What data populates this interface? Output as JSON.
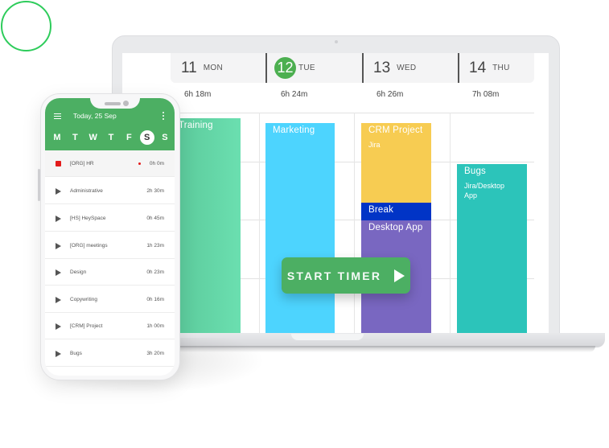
{
  "decor": {
    "circle_color": "#2ecc5b"
  },
  "calendar": {
    "days": [
      {
        "num": "11",
        "name": "MON",
        "total": "6h 18m",
        "today": false
      },
      {
        "num": "12",
        "name": "TUE",
        "total": "6h 24m",
        "today": true
      },
      {
        "num": "13",
        "name": "WED",
        "total": "6h 26m",
        "today": false
      },
      {
        "num": "14",
        "name": "THU",
        "total": "7h 08m",
        "today": false
      }
    ],
    "events": [
      {
        "day": "MON",
        "title": "Training",
        "subtitle": "",
        "color": "#66dcae"
      },
      {
        "day": "TUE",
        "title": "Marketing",
        "subtitle": "",
        "color": "#4dd4fe"
      },
      {
        "day": "WED",
        "title": "CRM Project",
        "subtitle": "Jira",
        "color": "#f7cc52"
      },
      {
        "day": "WED",
        "title": "Break",
        "subtitle": "",
        "color": "#0134c6"
      },
      {
        "day": "WED",
        "title": "Desktop App",
        "subtitle": "",
        "color": "#7967c1"
      },
      {
        "day": "THU",
        "title": "Bugs",
        "subtitle": "Jira/Desktop App",
        "color": "#2cc4ba"
      }
    ],
    "start_timer_label": "START TIMER",
    "accent": "#4caf63"
  },
  "phone": {
    "date_label": "Today, 25 Sep",
    "weekdays": [
      "M",
      "T",
      "W",
      "T",
      "F",
      "S",
      "S"
    ],
    "active_weekday_index": 5,
    "tasks": [
      {
        "name": "[ORG] HR",
        "duration": "0h 0m",
        "state": "recording"
      },
      {
        "name": "Administrative",
        "duration": "2h 30m",
        "state": "stopped"
      },
      {
        "name": "[HS] HeySpace",
        "duration": "0h 45m",
        "state": "stopped"
      },
      {
        "name": "[ORG] meetings",
        "duration": "1h 23m",
        "state": "stopped"
      },
      {
        "name": "Design",
        "duration": "0h 23m",
        "state": "stopped"
      },
      {
        "name": "Copywriting",
        "duration": "0h 16m",
        "state": "stopped"
      },
      {
        "name": "[CRM] Project",
        "duration": "1h 00m",
        "state": "stopped"
      },
      {
        "name": "Bugs",
        "duration": "3h 20m",
        "state": "stopped"
      }
    ]
  }
}
